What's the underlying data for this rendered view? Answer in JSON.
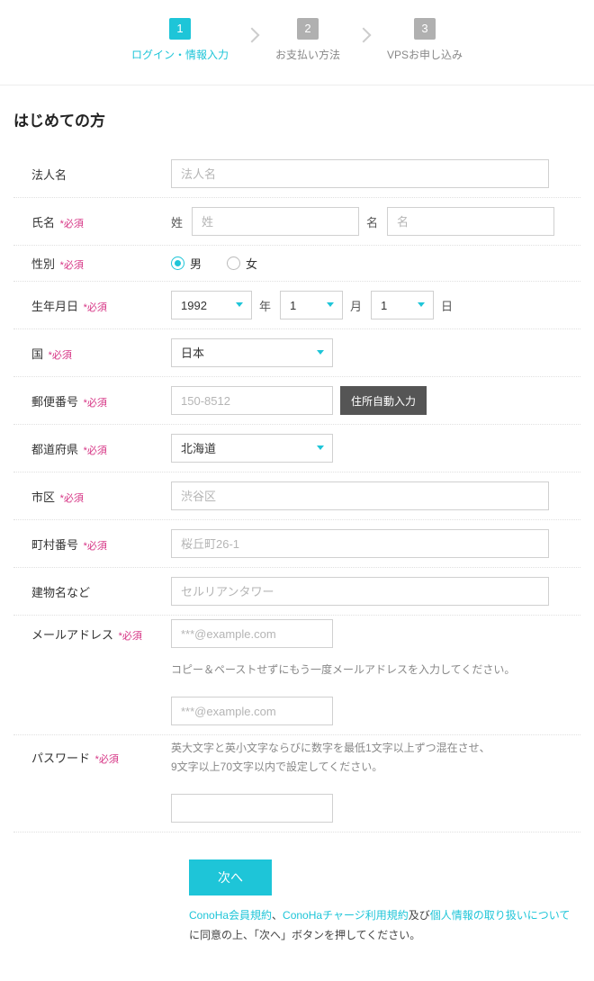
{
  "steps": {
    "s1": {
      "num": "1",
      "label": "ログイン・情報入力"
    },
    "s2": {
      "num": "2",
      "label": "お支払い方法"
    },
    "s3": {
      "num": "3",
      "label": "VPSお申し込み"
    }
  },
  "heading": "はじめての方",
  "required": "*必須",
  "labels": {
    "company": "法人名",
    "name": "氏名",
    "lastname_sub": "姓",
    "firstname_sub": "名",
    "gender": "性別",
    "birth": "生年月日",
    "year_sub": "年",
    "month_sub": "月",
    "day_sub": "日",
    "country": "国",
    "postal": "郵便番号",
    "pref": "都道府県",
    "city": "市区",
    "address": "町村番号",
    "building": "建物名など",
    "email": "メールアドレス",
    "password": "パスワード"
  },
  "placeholders": {
    "company": "法人名",
    "lastname": "姓",
    "firstname": "名",
    "postal": "150-8512",
    "city": "渋谷区",
    "address": "桜丘町26-1",
    "building": "セルリアンタワー",
    "email": "***@example.com",
    "email2": "***@example.com"
  },
  "values": {
    "year": "1992",
    "month": "1",
    "day": "1",
    "country": "日本",
    "pref": "北海道"
  },
  "gender": {
    "male": "男",
    "female": "女"
  },
  "buttons": {
    "autofill": "住所自動入力",
    "next": "次へ"
  },
  "hints": {
    "email_confirm": "コピー＆ペーストせずにもう一度メールアドレスを入力してください。",
    "password1": "英大文字と英小文字ならびに数字を最低1文字以上ずつ混在させ、",
    "password2": "9文字以上70文字以内で設定してください。"
  },
  "terms": {
    "link1": "ConoHa会員規約",
    "sep1": "、",
    "link2": "ConoHaチャージ利用規約",
    "text1": "及び",
    "link3": "個人情報の取り扱いについて",
    "text2": "に同意の上、「次へ」ボタンを押してください。"
  }
}
